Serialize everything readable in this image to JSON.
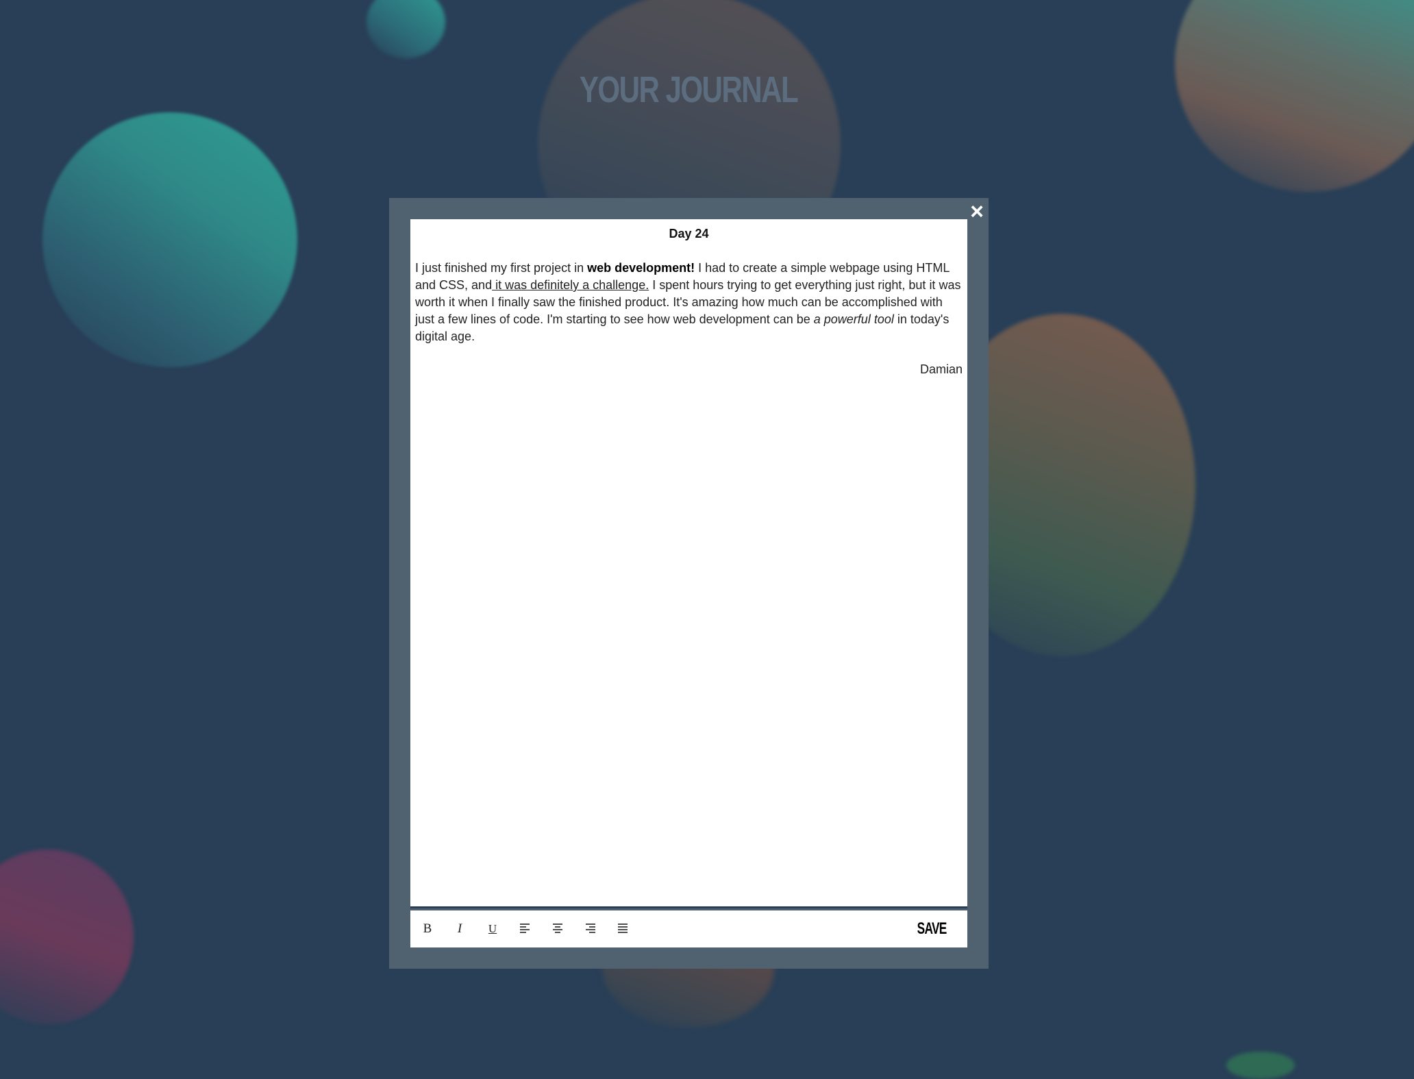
{
  "header": {
    "title": "YOUR JOURNAL"
  },
  "modal": {
    "close_icon": "×",
    "entry": {
      "title": "Day 24",
      "text_parts": [
        "I just finished my first project in ",
        "web development!",
        " I had to create a simple webpage using HTML and CSS, and",
        " it was definitely a challenge.",
        " I spent hours trying to get everything just right, but it was worth it when I finally saw the finished product. It's amazing how much can be accomplished with just a few lines of code. I'm starting to see how web development can be ",
        "a powerful tool",
        " in today's digital age."
      ],
      "signature": "Damian"
    },
    "toolbar": {
      "bold_label": "B",
      "italic_label": "I",
      "underline_label": "U",
      "icons": [
        "bold-icon",
        "italic-icon",
        "underline-icon",
        "align-left-icon",
        "align-center-icon",
        "align-right-icon",
        "align-justify-icon"
      ],
      "save_label": "SAVE"
    }
  },
  "colors": {
    "background": "#283f57",
    "modal_frame": "#506170",
    "paper": "#ffffff",
    "title": "#5b6d7f"
  }
}
